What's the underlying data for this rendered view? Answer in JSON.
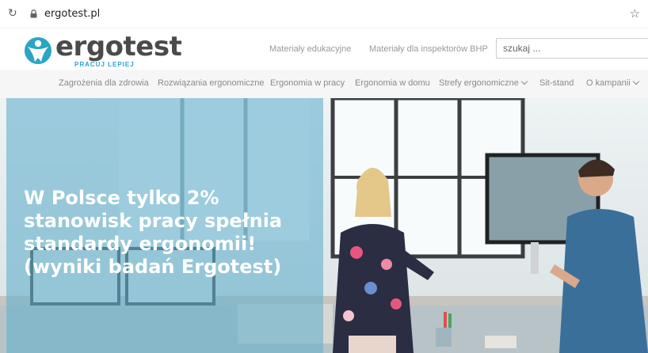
{
  "browser": {
    "url": "ergotest.pl"
  },
  "logo": {
    "name": "ergotest",
    "tagline": "PRACUJ LEPIEJ"
  },
  "top_links": [
    "Materiały edukacyjne",
    "Materiały dla inspektorów BHP"
  ],
  "search": {
    "placeholder": "szukaj ..."
  },
  "nav": {
    "items": [
      {
        "label": "Zagrożenia dla zdrowia"
      },
      {
        "label": "Rozwiązania ergonomiczne"
      },
      {
        "label": "Ergonomia w pracy"
      },
      {
        "label": "Ergonomia w domu"
      },
      {
        "label": "Strefy ergonomiczne"
      },
      {
        "label": "Sit-stand"
      },
      {
        "label": "O kampanii"
      }
    ]
  },
  "hero": {
    "title": "W Polsce tylko 2% stanowisk pracy spełnia standardy ergonomii! (wyniki badań Ergotest)"
  },
  "colors": {
    "brand_blue": "#2aa5c4",
    "overlay": "#68b2cd",
    "nav_bg": "#f6f6f6"
  }
}
